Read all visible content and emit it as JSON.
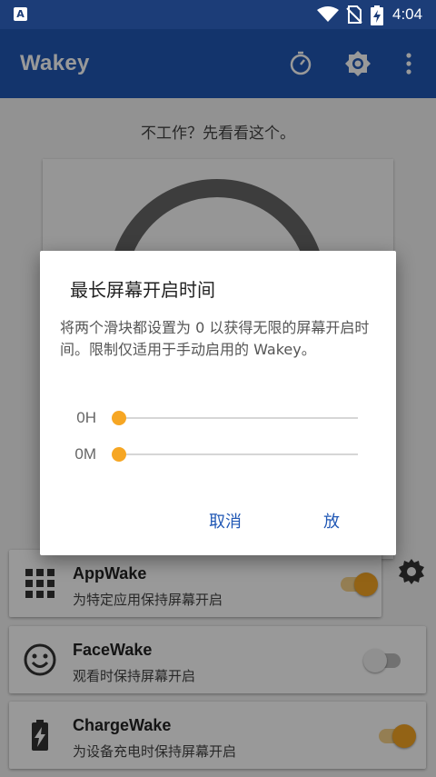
{
  "status_bar": {
    "time": "4:04",
    "app_badge": "A"
  },
  "app_bar": {
    "title": "Wakey",
    "actions": [
      "timer-icon",
      "settings-brightness-icon",
      "overflow-menu-icon"
    ]
  },
  "main": {
    "hint": "不工作？先看看这个。",
    "cards": [
      {
        "title": "AppWake",
        "subtitle": "为特定应用保持屏幕开启",
        "icon": "app-grid-icon",
        "enabled": true
      },
      {
        "title": "FaceWake",
        "subtitle": "观看时保持屏幕开启",
        "icon": "smiley-face-icon",
        "enabled": false
      },
      {
        "title": "ChargeWake",
        "subtitle": "为设备充电时保持屏幕开启",
        "icon": "battery-charging-icon",
        "enabled": true
      }
    ]
  },
  "dialog": {
    "title": "最长屏幕开启时间",
    "message": "将两个滑块都设置为 0 以获得无限的屏幕开启时间。限制仅适用于手动启用的 Wakey。",
    "sliders": [
      {
        "label": "0H",
        "value": 0
      },
      {
        "label": "0M",
        "value": 0
      }
    ],
    "cancel_label": "取消",
    "ok_label": "放"
  },
  "colors": {
    "primary": "#2158b5",
    "status_bar": "#1c3d78",
    "accent": "#f6a623"
  }
}
